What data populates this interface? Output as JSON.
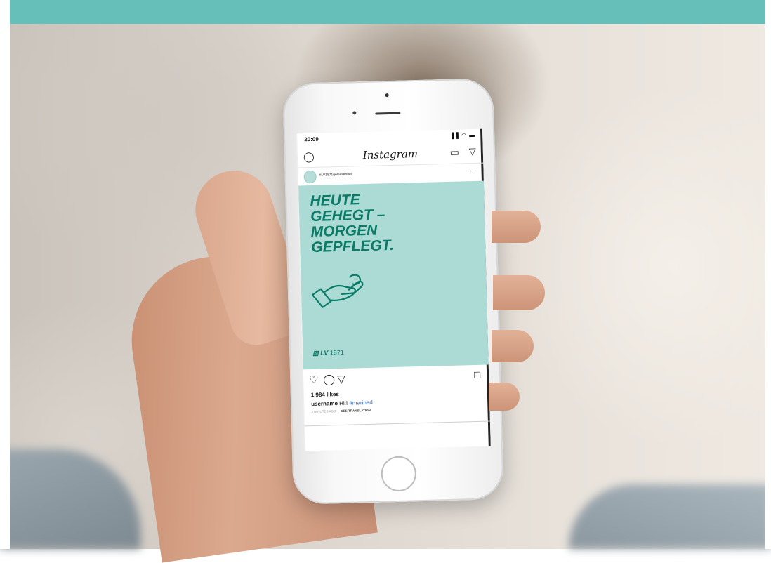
{
  "status_bar": {
    "time": "20:09",
    "icons": "▐▐ ◠ ▬"
  },
  "instagram": {
    "title": "Instagram",
    "icons": {
      "camera": "camera-icon",
      "igtv": "igtv-icon",
      "direct": "paper-plane-icon"
    }
  },
  "post": {
    "account": "#LV1871gelassenheit",
    "more": "…",
    "headline": [
      "HEUTE",
      "GEHEGT –",
      "MORGEN",
      "GEPFLEGT."
    ],
    "brand": "LV",
    "brand_year": "1871",
    "likes": "1.984 likes",
    "caption_user": "username",
    "caption_text": "Hi!!",
    "caption_tags": "#marinad",
    "meta": "2 MINUTES AGO",
    "see_translation": "SEE TRANSLATION"
  },
  "colors": {
    "frame_teal": "#66bfb8",
    "post_background": "#acdbd6",
    "brand_green": "#0b7a67"
  }
}
